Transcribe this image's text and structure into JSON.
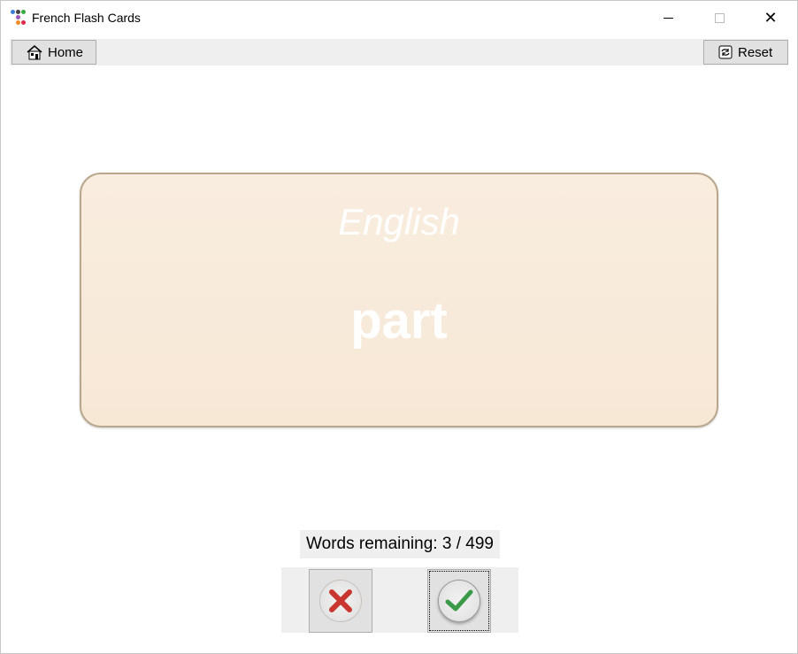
{
  "window": {
    "title": "French Flash Cards",
    "icons": [
      "minimize-icon",
      "maximize-icon",
      "close-icon"
    ]
  },
  "toolbar": {
    "home_label": "Home",
    "reset_label": "Reset"
  },
  "card": {
    "language": "English",
    "word": "part"
  },
  "status": {
    "remaining": "Words remaining: 3 / 499"
  },
  "colors": {
    "card_bg": "#f8ecdc",
    "wrong": "#c8362f",
    "right": "#3a9a47"
  }
}
